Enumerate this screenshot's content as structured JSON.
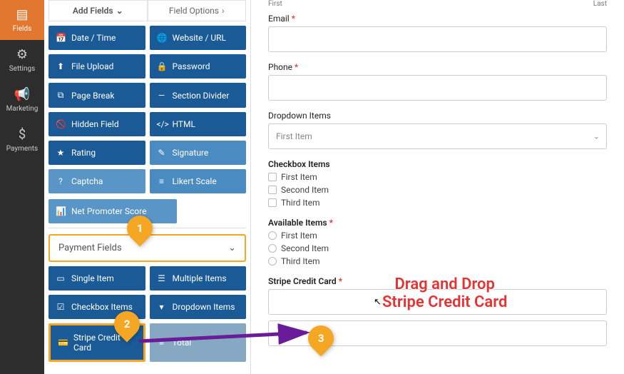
{
  "nav": [
    {
      "key": "fields",
      "label": "Fields",
      "icon": "▤",
      "active": true
    },
    {
      "key": "settings",
      "label": "Settings",
      "icon": "⚙",
      "active": false
    },
    {
      "key": "marketing",
      "label": "Marketing",
      "icon": "📢",
      "active": false
    },
    {
      "key": "payments",
      "label": "Payments",
      "icon": "$",
      "active": false
    }
  ],
  "tabs": {
    "add_fields": "Add Fields",
    "field_options": "Field Options"
  },
  "fancy_fields": [
    {
      "label": "Date / Time",
      "icon": "📅",
      "class": ""
    },
    {
      "label": "Website / URL",
      "icon": "🌐",
      "class": ""
    },
    {
      "label": "File Upload",
      "icon": "⬆",
      "class": ""
    },
    {
      "label": "Password",
      "icon": "🔒",
      "class": ""
    },
    {
      "label": "Page Break",
      "icon": "⧉",
      "class": ""
    },
    {
      "label": "Section Divider",
      "icon": "—",
      "class": ""
    },
    {
      "label": "Hidden Field",
      "icon": "🚫",
      "class": ""
    },
    {
      "label": "HTML",
      "icon": "</>",
      "class": ""
    },
    {
      "label": "Rating",
      "icon": "★",
      "class": ""
    },
    {
      "label": "Signature",
      "icon": "✎",
      "class": "light"
    },
    {
      "label": "Captcha",
      "icon": "?",
      "class": "lighter"
    },
    {
      "label": "Likert Scale",
      "icon": "≡",
      "class": "light"
    },
    {
      "label": "Net Promoter Score",
      "icon": "📊",
      "class": "lighter",
      "wide": true
    }
  ],
  "section_header": "Payment Fields",
  "payment_fields": [
    {
      "label": "Single Item",
      "icon": "▭",
      "class": ""
    },
    {
      "label": "Multiple Items",
      "icon": "☰",
      "class": ""
    },
    {
      "label": "Checkbox Items",
      "icon": "☑",
      "class": ""
    },
    {
      "label": "Dropdown Items",
      "icon": "▾",
      "class": ""
    },
    {
      "label": "Stripe Credit Card",
      "icon": "💳",
      "class": "highlight"
    },
    {
      "label": "Total",
      "icon": "≡",
      "class": "dim"
    }
  ],
  "form": {
    "first_label": "First",
    "last_label": "Last",
    "email_label": "Email",
    "phone_label": "Phone",
    "dropdown_label": "Dropdown Items",
    "dropdown_value": "First Item",
    "checkbox_label": "Checkbox Items",
    "available_label": "Available Items",
    "options": [
      "First Item",
      "Second Item",
      "Third Item"
    ],
    "stripe_label": "Stripe Credit Card"
  },
  "callouts": {
    "c1": "1",
    "c2": "2",
    "c3": "3"
  },
  "instruction": {
    "line1": "Drag and Drop",
    "line2": "Stripe Credit Card"
  },
  "colors": {
    "accent": "#f5a623",
    "primary": "#1a5a96",
    "nav_active": "#e27730",
    "arrow": "#6a1b9a"
  }
}
